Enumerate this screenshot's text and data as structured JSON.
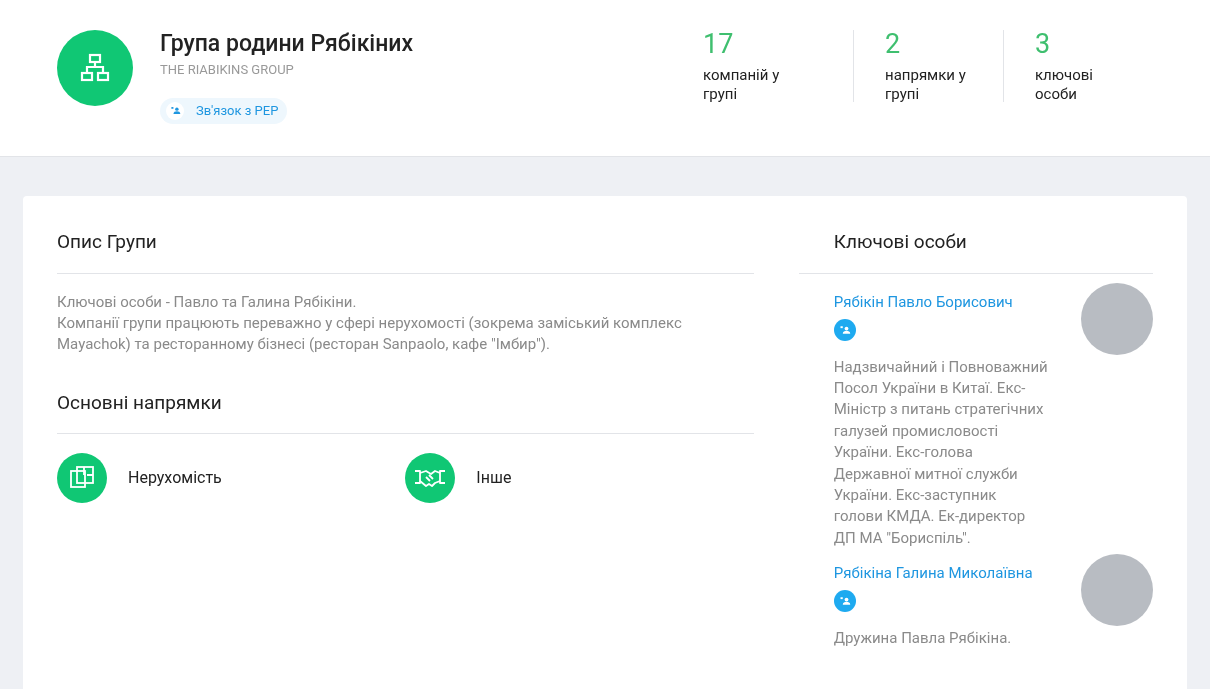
{
  "header": {
    "title": "Група родини Рябікіних",
    "subtitle": "THE RIABIKINS GROUP",
    "pep_link": "Зв'язок з PEP",
    "stats": [
      {
        "value": "17",
        "label": "компаній у групі"
      },
      {
        "value": "2",
        "label": "напрямки у групі"
      },
      {
        "value": "3",
        "label": "ключові особи"
      }
    ]
  },
  "description": {
    "title": "Опис Групи",
    "lines": [
      "Ключові особи - Павло та Галина Рябікіни.",
      "Компанії групи працюють переважно у сфері нерухомості (зокрема заміський комплекс Mayachok) та ресторанному бізнесі (ресторан Sanpaolo, кафе \"Імбир\")."
    ]
  },
  "directions": {
    "title": "Основні напрямки",
    "items": [
      {
        "kind": "realty",
        "label": "Нерухомість"
      },
      {
        "kind": "handshake",
        "label": "Інше"
      }
    ]
  },
  "key_persons": {
    "title": "Ключові особи",
    "people": [
      {
        "name": "Рябікін Павло Борисович",
        "bio": "Надзвичайний і Повноважний Посол України в Китаї. Екс-Міністр з питань стратегічних галузей промисловості України. Екс-голова Державної митної служби України. Екс-заступник голови КМДА. Ек-директор ДП МА \"Бориспіль\"."
      },
      {
        "name": "Рябікіна Галина Миколаївна",
        "bio": "Дружина Павла Рябікіна."
      }
    ]
  }
}
